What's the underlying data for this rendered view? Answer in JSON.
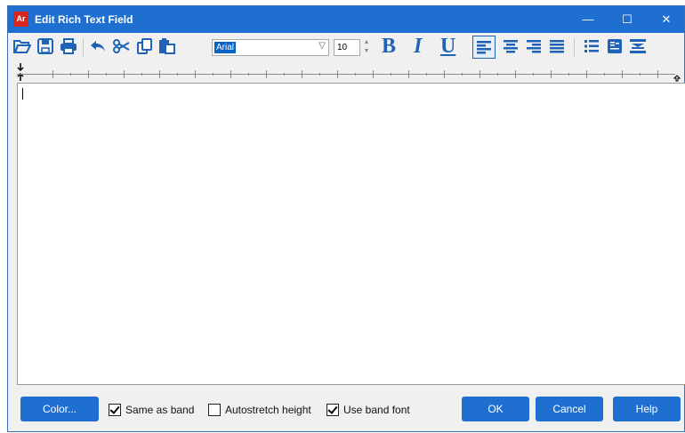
{
  "window": {
    "title": "Edit Rich Text Field",
    "app_icon_label": "Ar",
    "minimize": "—",
    "maximize": "☐",
    "close": "✕"
  },
  "toolbar": {
    "font_name": "Arial",
    "font_size": "10",
    "bold_label": "B",
    "italic_label": "I",
    "underline_label": "U"
  },
  "footer": {
    "color_button": "Color...",
    "same_as_band": {
      "label": "Same as band",
      "checked": true
    },
    "autostretch_height": {
      "label": "Autostretch height",
      "checked": false
    },
    "use_band_font": {
      "label": "Use band font",
      "checked": true
    },
    "ok_button": "OK",
    "cancel_button": "Cancel",
    "help_button": "Help"
  },
  "colors": {
    "accent": "#1f6fd1",
    "icon_blue": "#1f63b6"
  }
}
